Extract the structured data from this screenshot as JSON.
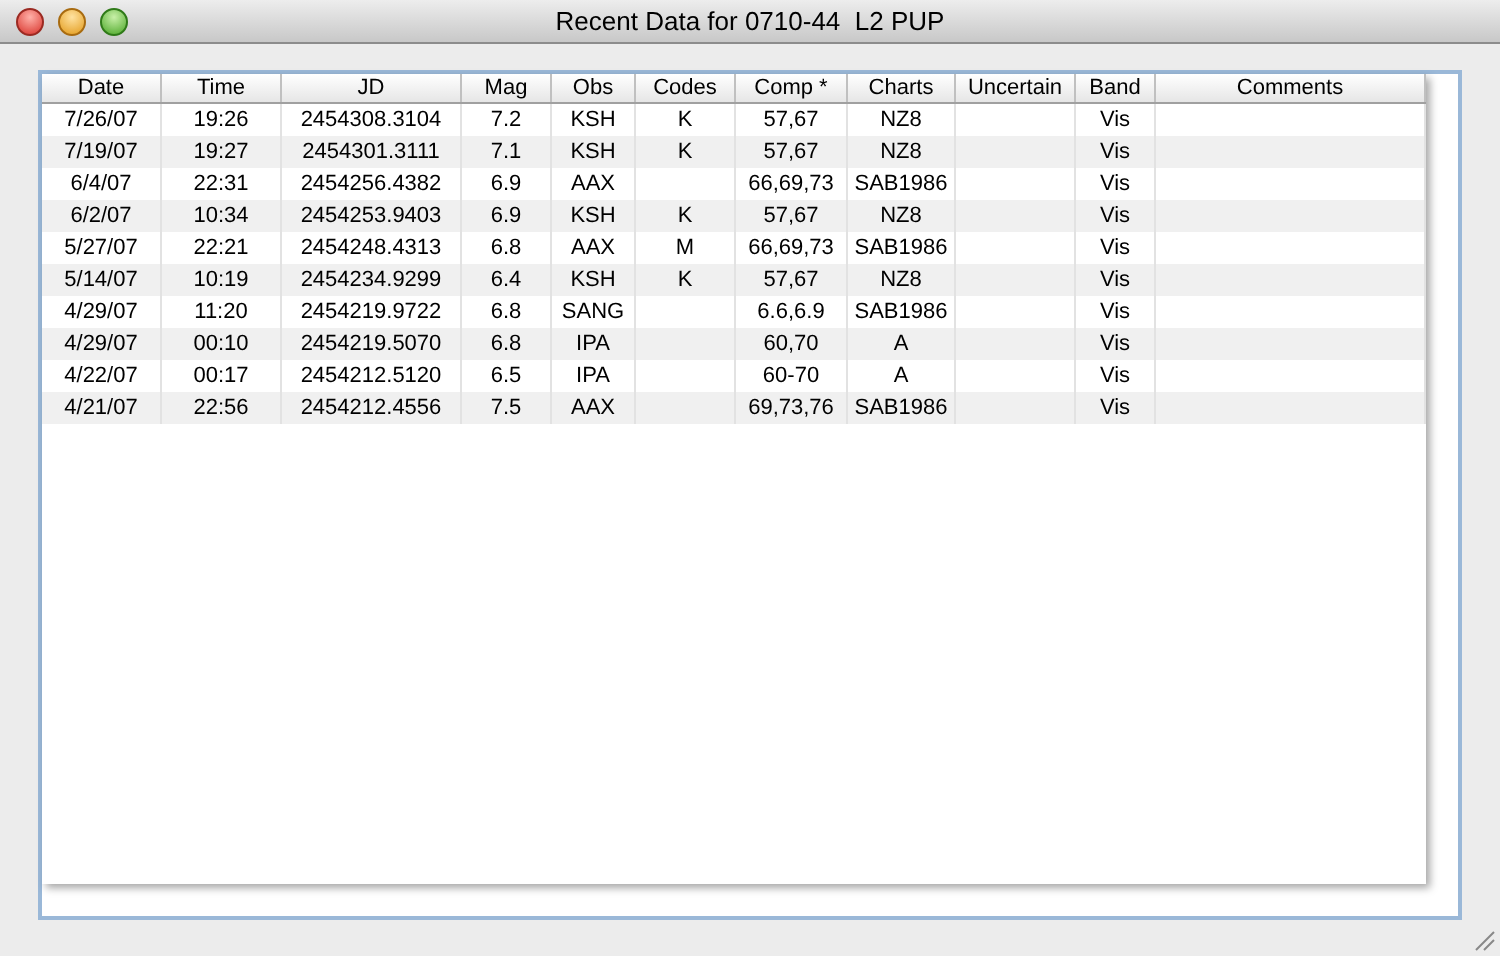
{
  "window": {
    "title": "Recent Data for 0710-44  L2 PUP"
  },
  "table": {
    "columns": [
      "Date",
      "Time",
      "JD",
      "Mag",
      "Obs",
      "Codes",
      "Comp *",
      "Charts",
      "Uncertain",
      "Band",
      "Comments"
    ],
    "rows": [
      [
        "7/26/07",
        "19:26",
        "2454308.3104",
        "7.2",
        "KSH",
        "K",
        "57,67",
        "NZ8",
        "",
        "Vis",
        ""
      ],
      [
        "7/19/07",
        "19:27",
        "2454301.3111",
        "7.1",
        "KSH",
        "K",
        "57,67",
        "NZ8",
        "",
        "Vis",
        ""
      ],
      [
        "6/4/07",
        "22:31",
        "2454256.4382",
        "6.9",
        "AAX",
        "",
        "66,69,73",
        "SAB1986",
        "",
        "Vis",
        ""
      ],
      [
        "6/2/07",
        "10:34",
        "2454253.9403",
        "6.9",
        "KSH",
        "K",
        "57,67",
        "NZ8",
        "",
        "Vis",
        ""
      ],
      [
        "5/27/07",
        "22:21",
        "2454248.4313",
        "6.8",
        "AAX",
        "M",
        "66,69,73",
        "SAB1986",
        "",
        "Vis",
        ""
      ],
      [
        "5/14/07",
        "10:19",
        "2454234.9299",
        "6.4",
        "KSH",
        "K",
        "57,67",
        "NZ8",
        "",
        "Vis",
        ""
      ],
      [
        "4/29/07",
        "11:20",
        "2454219.9722",
        "6.8",
        "SANG",
        "",
        "6.6,6.9",
        "SAB1986",
        "",
        "Vis",
        ""
      ],
      [
        "4/29/07",
        "00:10",
        "2454219.5070",
        "6.8",
        "IPA",
        "",
        "60,70",
        "A",
        "",
        "Vis",
        ""
      ],
      [
        "4/22/07",
        "00:17",
        "2454212.5120",
        "6.5",
        "IPA",
        "",
        "60-70",
        "A",
        "",
        "Vis",
        ""
      ],
      [
        "4/21/07",
        "22:56",
        "2454212.4556",
        "7.5",
        "AAX",
        "",
        "69,73,76",
        "SAB1986",
        "",
        "Vis",
        ""
      ]
    ]
  }
}
